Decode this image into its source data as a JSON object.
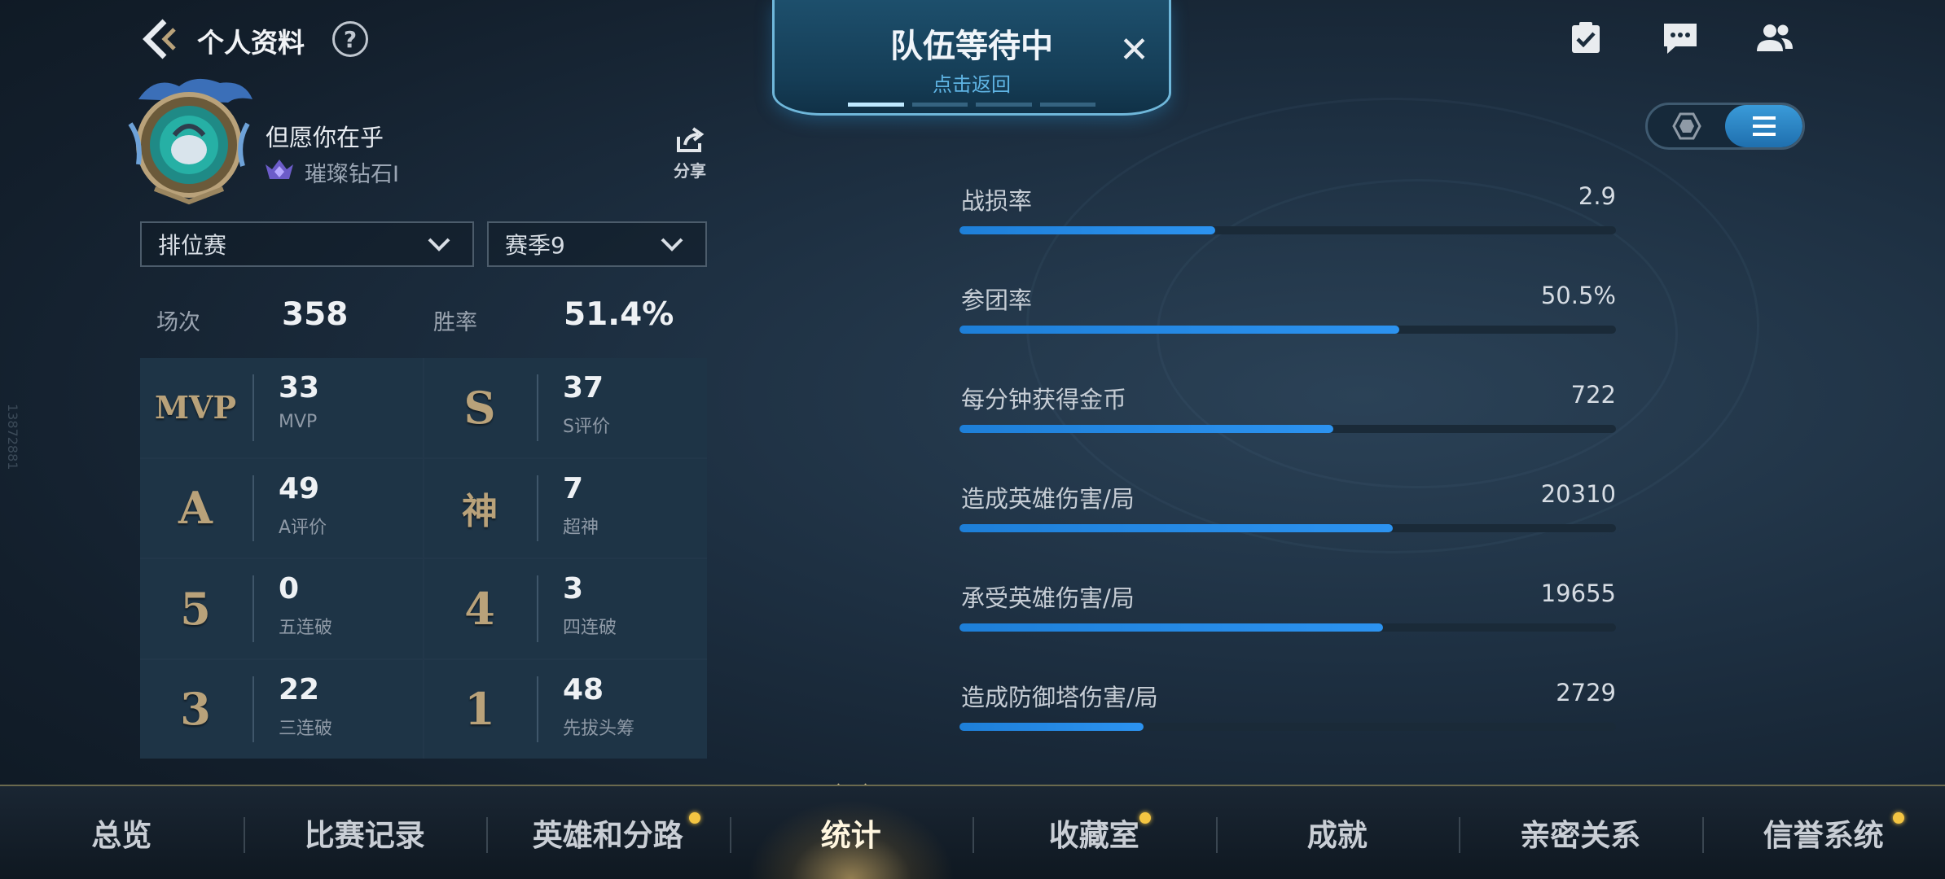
{
  "header": {
    "title": "个人资料",
    "help": "?"
  },
  "team_banner": {
    "title": "队伍等待中",
    "subtitle": "点击返回",
    "close": "✕"
  },
  "side_id": "13872881",
  "profile": {
    "name": "但愿你在乎",
    "rank": "璀璨钻石I",
    "share_label": "分享"
  },
  "filters": {
    "mode": "排位赛",
    "season": "赛季9"
  },
  "summary": {
    "games_label": "场次",
    "games_value": "358",
    "winrate_label": "胜率",
    "winrate_value": "51.4%"
  },
  "stats": [
    {
      "glyph": "MVP",
      "value": "33",
      "label": "MVP"
    },
    {
      "glyph": "S",
      "value": "37",
      "label": "S评价"
    },
    {
      "glyph": "A",
      "value": "49",
      "label": "A评价"
    },
    {
      "glyph": "神",
      "value": "7",
      "label": "超神"
    },
    {
      "glyph": "5",
      "value": "0",
      "label": "五连破"
    },
    {
      "glyph": "4",
      "value": "3",
      "label": "四连破"
    },
    {
      "glyph": "3",
      "value": "22",
      "label": "三连破"
    },
    {
      "glyph": "1",
      "value": "48",
      "label": "先拔头筹"
    }
  ],
  "metrics": [
    {
      "label": "战损率",
      "value": "2.9",
      "fill": 0.39
    },
    {
      "label": "参团率",
      "value": "50.5%",
      "fill": 0.67
    },
    {
      "label": "每分钟获得金币",
      "value": "722",
      "fill": 0.57
    },
    {
      "label": "造成英雄伤害/局",
      "value": "20310",
      "fill": 0.66
    },
    {
      "label": "承受英雄伤害/局",
      "value": "19655",
      "fill": 0.645
    },
    {
      "label": "造成防御塔伤害/局",
      "value": "2729",
      "fill": 0.28
    }
  ],
  "nav": {
    "tabs": [
      {
        "label": "总览",
        "dot": false
      },
      {
        "label": "比赛记录",
        "dot": false
      },
      {
        "label": "英雄和分路",
        "dot": true
      },
      {
        "label": "统计",
        "dot": false,
        "active": true
      },
      {
        "label": "收藏室",
        "dot": true
      },
      {
        "label": "成就",
        "dot": false
      },
      {
        "label": "亲密关系",
        "dot": false
      },
      {
        "label": "信誉系统",
        "dot": true
      }
    ]
  },
  "colors": {
    "accent_blue": "#1e7fd8",
    "glyph_gold": "#b9a27a",
    "notification_dot": "#f4c542"
  },
  "icons": {
    "back": "back-arrow-icon",
    "task": "task-checklist-icon",
    "chat": "chat-icon",
    "friends": "friends-icon",
    "share": "share-icon",
    "grid_view": "hexagon-view-icon",
    "list_view": "list-view-icon"
  }
}
